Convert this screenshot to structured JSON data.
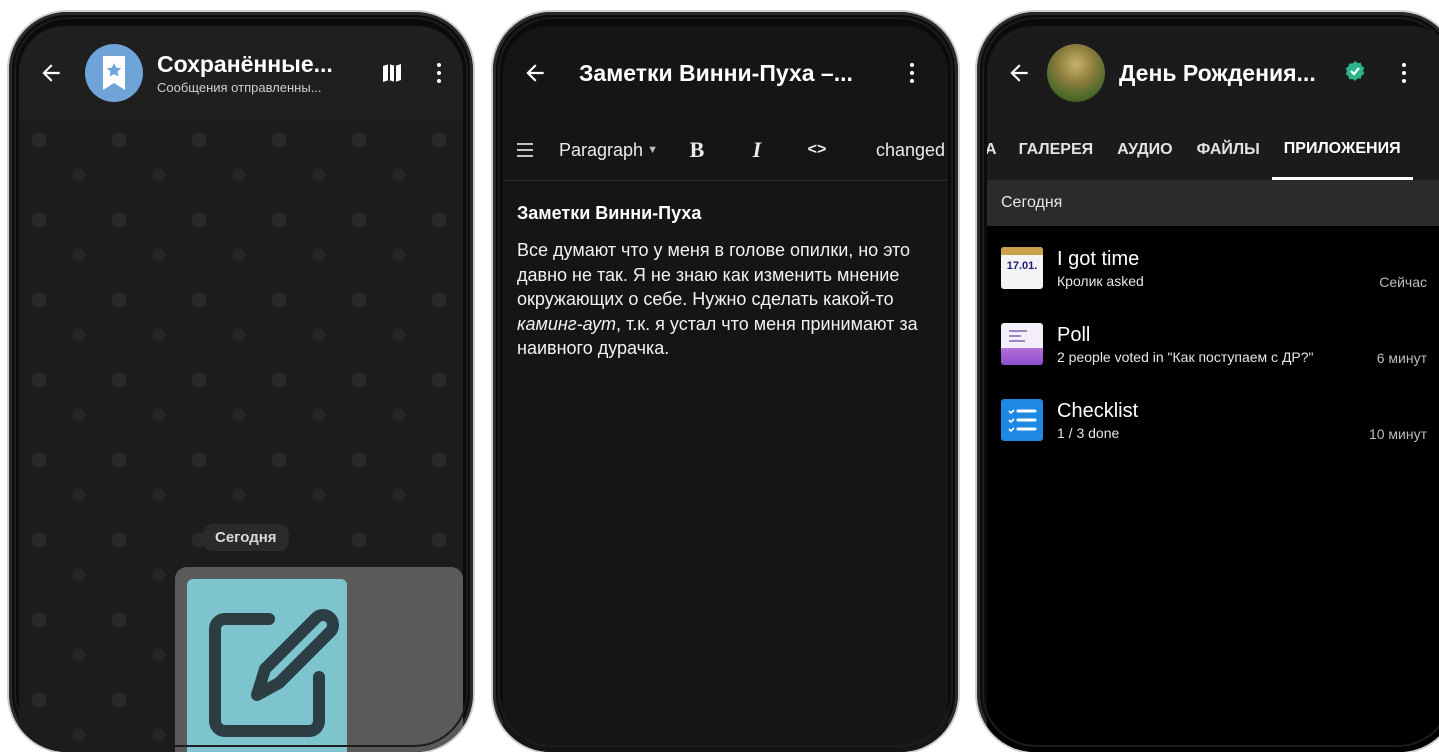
{
  "phone1": {
    "title": "Сохранённые...",
    "subtitle": "Сообщения отправленны...",
    "date_label": "Сегодня"
  },
  "phone2": {
    "title": "Заметки Винни-Пуха –...",
    "toolbar": {
      "paragraph": "Paragraph",
      "bold": "B",
      "italic": "I",
      "code": "<>",
      "status": "changed"
    },
    "note_title": "Заметки Винни-Пуха",
    "note_body": {
      "part1": "Все думают что у меня в голове опилки, но это давно не так. Я не знаю как изменить мнение окружающих о себе. Нужно сделать какой-то ",
      "italic": "каминг-аут",
      "part2": ", т.к. я устал что меня принимают за наивного дурачка."
    }
  },
  "phone3": {
    "title": "День Рождения...",
    "tabs": [
      "А",
      "ГАЛЕРЕЯ",
      "АУДИО",
      "ФАЙЛЫ",
      "ПРИЛОЖЕНИЯ"
    ],
    "active_tab": "ПРИЛОЖЕНИЯ",
    "section": "Сегодня",
    "apps": [
      {
        "name": "I got time",
        "desc": "Кролик asked",
        "time": "Сейчас",
        "icon": "calendar-icon",
        "icon_text": "17.01."
      },
      {
        "name": "Poll",
        "desc": "2 people voted in \"Как поступаем с ДР?\"",
        "time": "6 минут",
        "icon": "poll-icon"
      },
      {
        "name": "Checklist",
        "desc": "1 / 3 done",
        "time": "10 минут",
        "icon": "checklist-icon"
      }
    ],
    "verified_color": "#2bb48a"
  }
}
